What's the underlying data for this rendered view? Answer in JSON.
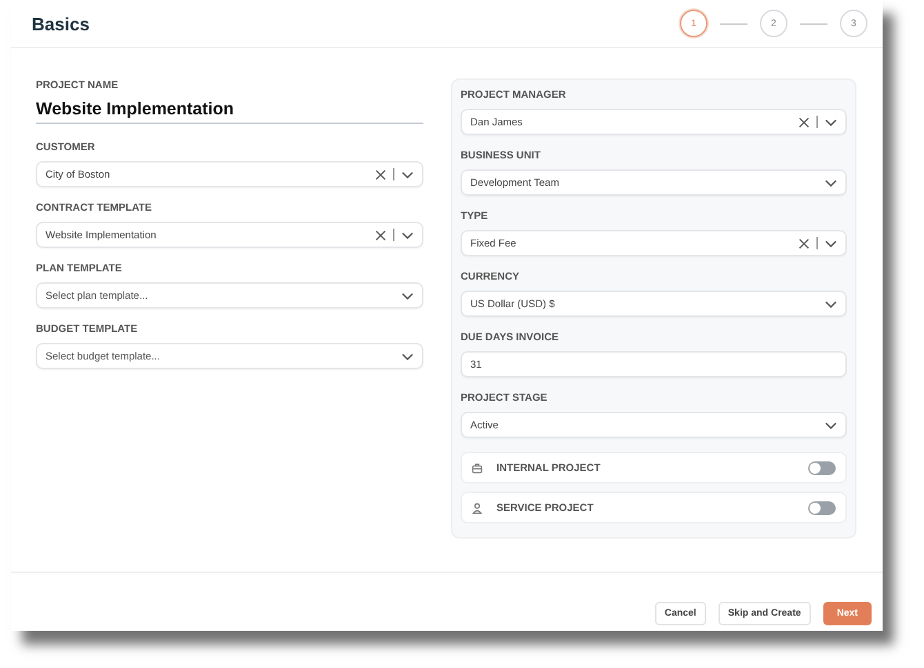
{
  "title": "Basics",
  "steps": [
    {
      "label": "1",
      "selected": true
    },
    {
      "label": "2",
      "selected": false
    },
    {
      "label": "3",
      "selected": false
    }
  ],
  "project_name": {
    "label": "PROJECT NAME",
    "value": "Website Implementation"
  },
  "left_fields": [
    {
      "label": "CUSTOMER",
      "value": "City of Boston",
      "clearable": true
    },
    {
      "label": "CONTRACT TEMPLATE",
      "value": "Website Implementation",
      "clearable": true
    },
    {
      "label": "PLAN TEMPLATE",
      "placeholder": "Select plan template...",
      "clearable": false
    },
    {
      "label": "BUDGET TEMPLATE",
      "placeholder": "Select budget template...",
      "clearable": false
    }
  ],
  "right_fields": [
    {
      "kind": "select",
      "label": "PROJECT MANAGER",
      "value": "Dan James",
      "clearable": true
    },
    {
      "kind": "select",
      "label": "BUSINESS UNIT",
      "value": "Development Team",
      "clearable": false
    },
    {
      "kind": "select",
      "label": "TYPE",
      "value": "Fixed Fee",
      "clearable": true
    },
    {
      "kind": "select",
      "label": "CURRENCY",
      "value": "US Dollar (USD) $",
      "clearable": false
    },
    {
      "kind": "input",
      "label": "DUE DAYS INVOICE",
      "value": "31"
    },
    {
      "kind": "select",
      "label": "PROJECT STAGE",
      "value": "Active",
      "clearable": false
    }
  ],
  "toggles": [
    {
      "kind": "briefcase",
      "label": "INTERNAL PROJECT",
      "on": false
    },
    {
      "kind": "person",
      "label": "SERVICE PROJECT",
      "on": false
    }
  ],
  "buttons": [
    {
      "kind": "secondary",
      "label": "Cancel"
    },
    {
      "kind": "secondary",
      "label": "Skip and Create"
    },
    {
      "kind": "primary",
      "label": "Next"
    }
  ]
}
